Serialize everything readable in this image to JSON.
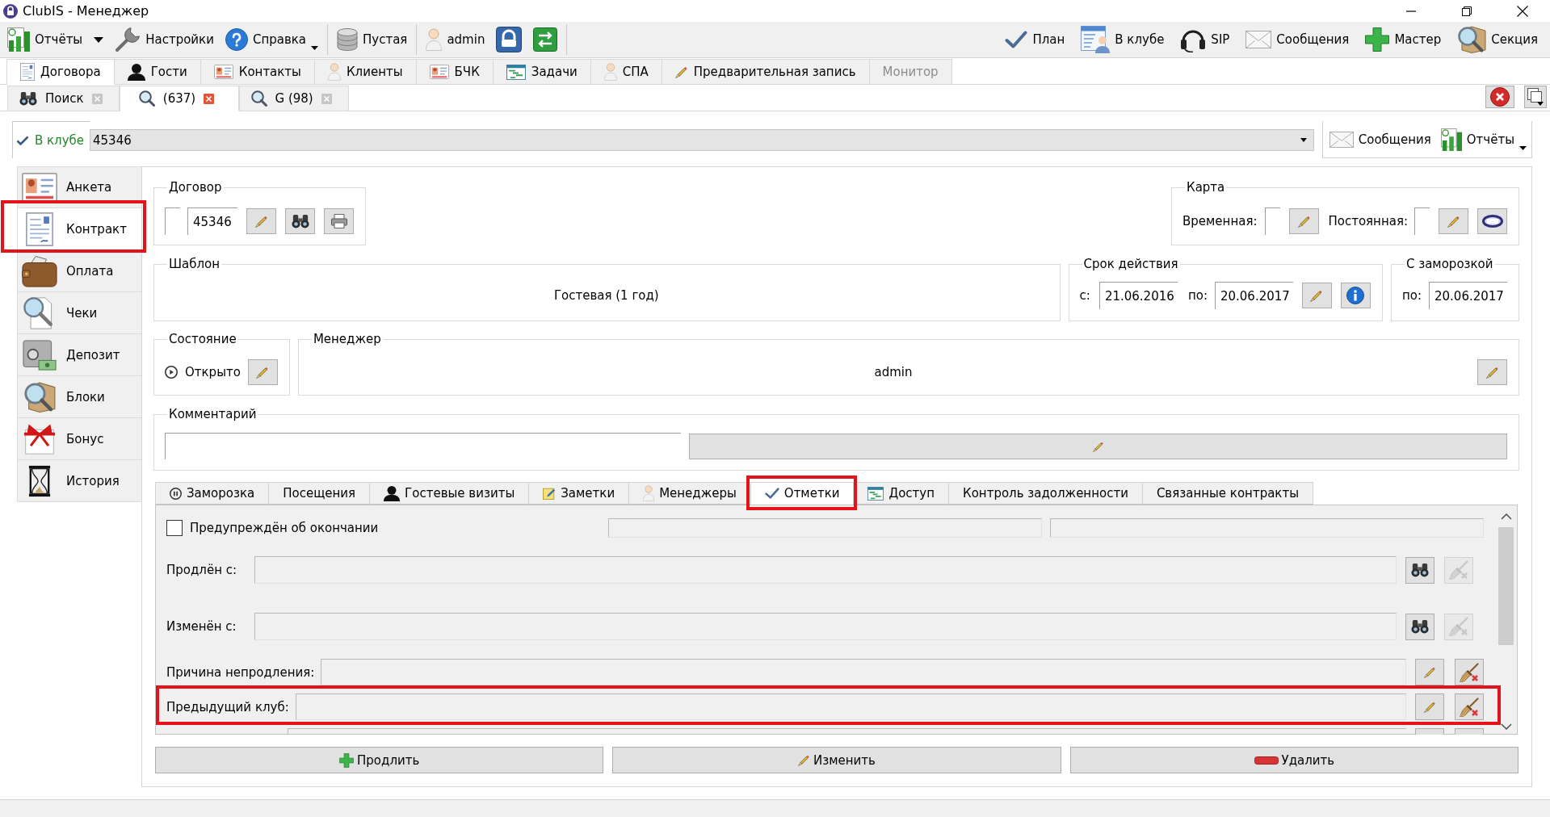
{
  "window": {
    "title": "ClubIS - Менеджер"
  },
  "toolbar": {
    "left_groups": [
      [
        {
          "label": "Отчёты",
          "kind": "dropdown"
        },
        {
          "label": "Настройки",
          "kind": "button"
        },
        {
          "label": "Справка",
          "kind": "menu"
        }
      ],
      [
        {
          "label": "Пустая",
          "kind": "button"
        }
      ],
      [
        {
          "label": "admin",
          "kind": "button"
        },
        {
          "kind": "icon_button"
        },
        {
          "kind": "icon_button"
        }
      ]
    ],
    "right": [
      {
        "label": "План"
      },
      {
        "label": "В клубе"
      },
      {
        "label": "SIP"
      },
      {
        "label": "Сообщения"
      },
      {
        "label": "Мастер"
      },
      {
        "label": "Секция"
      }
    ]
  },
  "main_tabs": [
    {
      "label": "Договора",
      "selected": true,
      "disabled": false
    },
    {
      "label": "Гости",
      "selected": false,
      "disabled": false
    },
    {
      "label": "Контакты",
      "selected": false,
      "disabled": false
    },
    {
      "label": "Клиенты",
      "selected": false,
      "disabled": false
    },
    {
      "label": "БЧК",
      "selected": false,
      "disabled": false
    },
    {
      "label": "Задачи",
      "selected": false,
      "disabled": false
    },
    {
      "label": "СПА",
      "selected": false,
      "disabled": false
    },
    {
      "label": "Предварительная запись",
      "selected": false,
      "disabled": false
    },
    {
      "label": "Монитор",
      "selected": false,
      "disabled": true
    }
  ],
  "doc_tabs": [
    {
      "label": "Поиск",
      "selected": false
    },
    {
      "label": "(637)",
      "selected": true
    },
    {
      "label": "G (98)",
      "selected": false
    }
  ],
  "club_bar": {
    "status": "В клубе",
    "value": "45346",
    "buttons": [
      {
        "label": "Сообщения",
        "kind": "button"
      },
      {
        "label": "Отчёты",
        "kind": "menu"
      }
    ]
  },
  "sidebar": {
    "items": [
      {
        "label": "Анкета",
        "selected": false,
        "highlighted": false
      },
      {
        "label": "Контракт",
        "selected": true,
        "highlighted": true
      },
      {
        "label": "Оплата",
        "selected": false,
        "highlighted": false
      },
      {
        "label": "Чеки",
        "selected": false,
        "highlighted": false
      },
      {
        "label": "Депозит",
        "selected": false,
        "highlighted": false
      },
      {
        "label": "Блоки",
        "selected": false,
        "highlighted": false
      },
      {
        "label": "Бонус",
        "selected": false,
        "highlighted": false
      },
      {
        "label": "История",
        "selected": false,
        "highlighted": false
      }
    ]
  },
  "contract_group": {
    "title": "Договор",
    "number": "45346"
  },
  "card_group": {
    "title": "Карта",
    "temporary_label": "Временная:",
    "permanent_label": "Постоянная:"
  },
  "template_group": {
    "title": "Шаблон",
    "value": "Гостевая (1 год)"
  },
  "validity_group": {
    "title": "Срок действия",
    "from_label": "с:",
    "from": "21.06.2016",
    "to_label": "по:",
    "to": "20.06.2017"
  },
  "freeze_group": {
    "title": "С заморозкой",
    "to_label": "по:",
    "to": "20.06.2017"
  },
  "state_group": {
    "title": "Состояние",
    "value": "Открыто"
  },
  "manager_group": {
    "title": "Менеджер",
    "value": "admin"
  },
  "comment_group": {
    "title": "Комментарий"
  },
  "detail_tabs": [
    {
      "label": "Заморозка",
      "selected": false,
      "highlighted": false
    },
    {
      "label": "Посещения",
      "selected": false,
      "highlighted": false
    },
    {
      "label": "Гостевые визиты",
      "selected": false,
      "highlighted": false
    },
    {
      "label": "Заметки",
      "selected": false,
      "highlighted": false
    },
    {
      "label": "Менеджеры",
      "selected": false,
      "highlighted": false
    },
    {
      "label": "Отметки",
      "selected": true,
      "highlighted": true
    },
    {
      "label": "Доступ",
      "selected": false,
      "highlighted": false
    },
    {
      "label": "Контроль задолженности",
      "selected": false,
      "highlighted": false
    },
    {
      "label": "Связанные контракты",
      "selected": false,
      "highlighted": false
    }
  ],
  "marks_panel": {
    "warned": {
      "label": "Предупреждён об окончании",
      "checked": false
    },
    "rows": [
      {
        "kind": "lookup",
        "label": "Продлён с:",
        "clear_disabled": true,
        "highlighted": false
      },
      {
        "kind": "lookup",
        "label": "Изменён с:",
        "clear_disabled": true,
        "highlighted": false
      },
      {
        "kind": "edit",
        "label": "Причина непродления:",
        "clear_disabled": false,
        "highlighted": false
      },
      {
        "kind": "edit",
        "label": "Предыдущий клуб:",
        "clear_disabled": false,
        "highlighted": true
      },
      {
        "kind": "partial",
        "highlighted": false
      }
    ]
  },
  "actions": [
    {
      "kind": "add",
      "label": "Продлить"
    },
    {
      "kind": "edit",
      "label": "Изменить"
    },
    {
      "kind": "delete",
      "label": "Удалить"
    }
  ]
}
